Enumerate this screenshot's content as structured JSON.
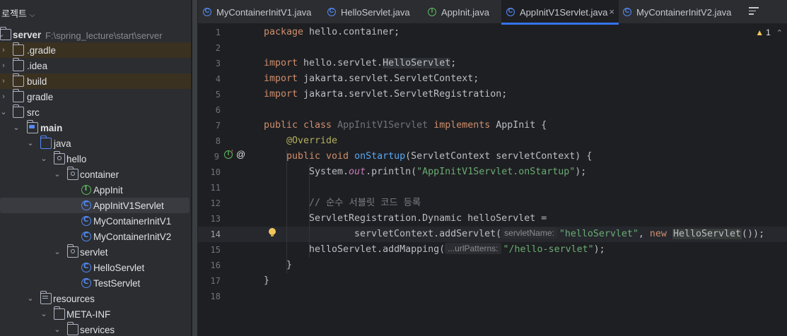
{
  "project_panel": {
    "title": "로젝트",
    "tree": [
      {
        "label": "server",
        "sub": "F:\\spring_lecture\\start\\server",
        "icon": "module-folder-icon",
        "depth": 0,
        "expanded": true
      },
      {
        "label": ".gradle",
        "icon": "folder-icon",
        "depth": 1,
        "expanded": false
      },
      {
        "label": ".idea",
        "icon": "folder-icon",
        "depth": 1,
        "expanded": false
      },
      {
        "label": "build",
        "icon": "folder-icon",
        "depth": 1,
        "expanded": false
      },
      {
        "label": "gradle",
        "icon": "folder-icon",
        "depth": 1,
        "expanded": false
      },
      {
        "label": "src",
        "icon": "folder-icon",
        "depth": 1,
        "expanded": true
      },
      {
        "label": "main",
        "icon": "source-root-folder-icon",
        "depth": 2,
        "expanded": true
      },
      {
        "label": "java",
        "icon": "source-folder-icon",
        "depth": 3,
        "expanded": true
      },
      {
        "label": "hello",
        "icon": "package-folder-icon",
        "depth": 4,
        "expanded": true
      },
      {
        "label": "container",
        "icon": "package-folder-icon",
        "depth": 5,
        "expanded": true
      },
      {
        "label": "AppInit",
        "icon": "interface-icon",
        "depth": 6
      },
      {
        "label": "AppInitV1Servlet",
        "icon": "class-icon",
        "depth": 6
      },
      {
        "label": "MyContainerInitV1",
        "icon": "class-icon",
        "depth": 6
      },
      {
        "label": "MyContainerInitV2",
        "icon": "class-icon",
        "depth": 6
      },
      {
        "label": "servlet",
        "icon": "package-folder-icon",
        "depth": 5,
        "expanded": true
      },
      {
        "label": "HelloServlet",
        "icon": "class-icon",
        "depth": 6
      },
      {
        "label": "TestServlet",
        "icon": "class-icon",
        "depth": 6
      },
      {
        "label": "resources",
        "icon": "resources-folder-icon",
        "depth": 3,
        "expanded": true
      },
      {
        "label": "META-INF",
        "icon": "folder-icon",
        "depth": 4,
        "expanded": true
      },
      {
        "label": "services",
        "icon": "folder-icon",
        "depth": 5,
        "expanded": true
      }
    ]
  },
  "tabs": [
    {
      "label": "MyContainerInitV1.java",
      "icon": "class-icon"
    },
    {
      "label": "HelloServlet.java",
      "icon": "class-icon"
    },
    {
      "label": "AppInit.java",
      "icon": "interface-icon"
    },
    {
      "label": "AppInitV1Servlet.java",
      "icon": "class-icon",
      "active": true,
      "close": "×"
    },
    {
      "label": "MyContainerInitV2.java",
      "icon": "class-icon"
    }
  ],
  "editor": {
    "warning_count": "1",
    "warning_symbol": "▲",
    "line_numbers": [
      "1",
      "2",
      "3",
      "4",
      "5",
      "6",
      "7",
      "8",
      "9",
      "10",
      "11",
      "12",
      "13",
      "14",
      "15",
      "16",
      "17",
      "18"
    ],
    "current_line": "14",
    "code": {
      "l1_kw": "package",
      "l1_rest": " hello.container;",
      "l3_kw": "import",
      "l3_pre": " hello.servlet.",
      "l3_cls": "HelloServlet",
      "l3_end": ";",
      "l4_kw": "import",
      "l4_rest": " jakarta.servlet.ServletContext;",
      "l5_kw": "import",
      "l5_rest": " jakarta.servlet.ServletRegistration;",
      "l7_kw1": "public class",
      "l7_name": " AppInitV1Servlet ",
      "l7_kw2": "implements",
      "l7_rest": " AppInit {",
      "l8_ann": "@Override",
      "l9_kw": "public void",
      "l9_fn": "onStartup",
      "l9_rest": "(ServletContext servletContext) {",
      "l10_pre": "System.",
      "l10_field": "out",
      "l10_mid": ".println(",
      "l10_str": "\"AppInitV1Servlet.onStartup\"",
      "l10_end": ");",
      "l12_comment": "// 순수 서블릿 코드 등록",
      "l13_text": "ServletRegistration.Dynamic helloServlet =",
      "l14_pre": "servletContext.addServlet(",
      "l14_hint": "servletName:",
      "l14_str": "\"helloServlet\"",
      "l14_sep": ", ",
      "l14_kw": "new",
      "l14_cls": "HelloServlet",
      "l14_end": "());",
      "l15_pre": "helloServlet.addMapping(",
      "l15_hint": "...urlPatterns:",
      "l15_str": "\"/hello-servlet\"",
      "l15_end": ");",
      "l16": "}",
      "l17": "}"
    }
  }
}
